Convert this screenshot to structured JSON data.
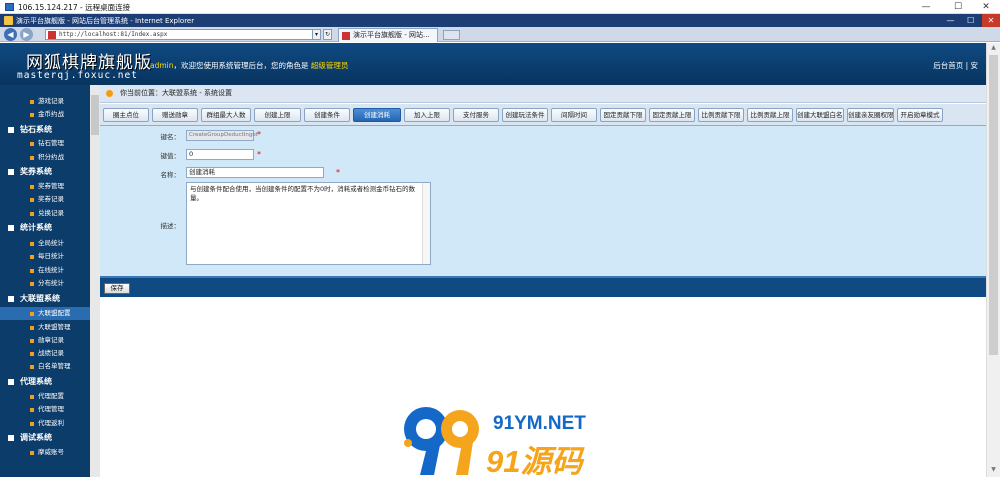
{
  "rdp": {
    "title": "106.15.124.217 - 远程桌面连接",
    "controls": [
      "—",
      "☐",
      "✕"
    ]
  },
  "ie": {
    "title": "演示平台旗舰版 - 网站后台管理系统 - Internet Explorer",
    "url": "http://localhost:81/Index.aspx",
    "tab_label": "演示平台旗舰版 - 网站...",
    "window_buttons": [
      "—",
      "☐",
      "✕"
    ]
  },
  "header": {
    "logo_main": "网狐棋牌旗舰版",
    "logo_sub": "masterqj.foxuc.net",
    "welcome_user": "admin",
    "welcome_text": "，欢迎您使用系统管理后台，您的角色是",
    "role": "超级管理员",
    "right_links": "后台首页 | 安"
  },
  "sidebar": {
    "groups": [
      {
        "label": "",
        "items": [
          "游戏记录",
          "金币约战"
        ]
      },
      {
        "label": "钻石系统",
        "items": [
          "钻石管理",
          "积分约战"
        ]
      },
      {
        "label": "奖券系统",
        "items": [
          "奖券管理",
          "奖券记录",
          "兑换记录"
        ]
      },
      {
        "label": "统计系统",
        "items": [
          "全局统计",
          "每日统计",
          "在线统计",
          "分布统计"
        ]
      },
      {
        "label": "大联盟系统",
        "items": [
          "大联盟配置",
          "大联盟管理",
          "勋章记录",
          "战绩记录",
          "白名单管理"
        ]
      },
      {
        "label": "代理系统",
        "items": [
          "代理配置",
          "代理管理",
          "代理返利"
        ]
      },
      {
        "label": "调试系统",
        "items": [
          "摩威账号"
        ]
      }
    ],
    "active_item": "大联盟配置"
  },
  "breadcrumb": {
    "prefix": "你当前位置：",
    "path": "大联盟系统 - 系统设置"
  },
  "tabs": [
    "圈主点位",
    "赠送勋章",
    "群组最大人数",
    "创建上限",
    "创建条件",
    "创建消耗",
    "加入上限",
    "支付服务",
    "创建玩法条件",
    "间隔时间",
    "固定贡献下限",
    "固定贡献上限",
    "比例贡献下限",
    "比例贡献上限",
    "创建大联盟白名单",
    "创建亲友圈权限",
    "开启勋章模式"
  ],
  "active_tab": "创建消耗",
  "form": {
    "key_label": "键名：",
    "key_value": "CreateGroupDeductIngot",
    "value_label": "键值：",
    "value_value": "0",
    "name_label": "名称：",
    "name_value": "创建消耗",
    "desc_label": "描述：",
    "desc_value": "与创建条件配合使用，当创建条件的配置不为0时，消耗或者检测金币钻石的数量。",
    "required_mark": "*"
  },
  "save_label": "保存",
  "watermark": {
    "line1": "91YM.NET",
    "line2": "91源码"
  }
}
